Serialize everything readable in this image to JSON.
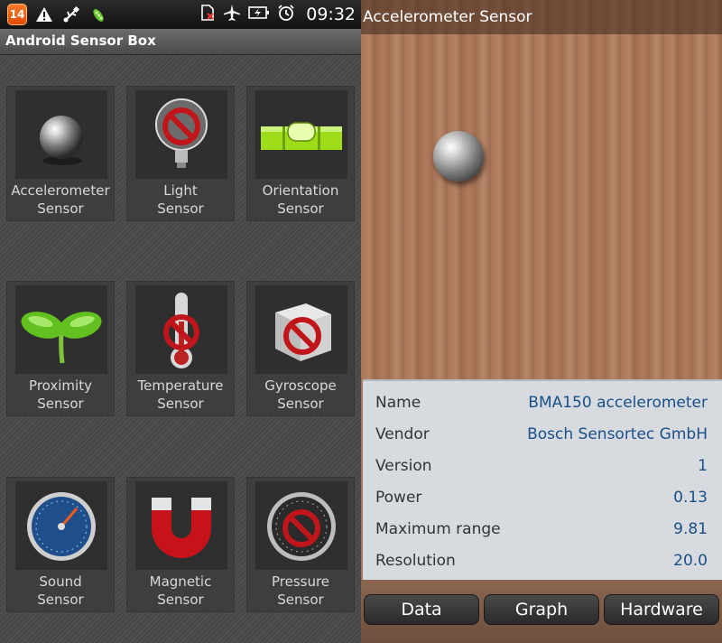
{
  "status_bar": {
    "notification_count": "14",
    "icons": [
      "warning-icon",
      "usb-icon",
      "peapod-app-icon"
    ],
    "right_icons": [
      "no-sim-icon",
      "airplane-icon",
      "battery-charging-icon",
      "alarm-icon"
    ],
    "time": "09:32"
  },
  "left_app": {
    "title": "Android Sensor Box",
    "tiles": [
      {
        "line1": "Accelerometer",
        "line2": "Sensor",
        "icon": "steel-ball-icon"
      },
      {
        "line1": "Light",
        "line2": "Sensor",
        "icon": "light-bulb-disabled-icon"
      },
      {
        "line1": "Orientation",
        "line2": "Sensor",
        "icon": "spirit-level-icon"
      },
      {
        "line1": "Proximity",
        "line2": "Sensor",
        "icon": "sprout-icon"
      },
      {
        "line1": "Temperature",
        "line2": "Sensor",
        "icon": "thermometer-disabled-icon"
      },
      {
        "line1": "Gyroscope",
        "line2": "Sensor",
        "icon": "cube-disabled-icon"
      },
      {
        "line1": "Sound",
        "line2": "Sensor",
        "icon": "gauge-icon"
      },
      {
        "line1": "Magnetic",
        "line2": "Sensor",
        "icon": "magnet-icon"
      },
      {
        "line1": "Pressure",
        "line2": "Sensor",
        "icon": "pressure-gauge-disabled-icon"
      }
    ]
  },
  "right_app": {
    "title": "Accelerometer Sensor",
    "info": [
      {
        "label": "Name",
        "value": "BMA150 accelerometer"
      },
      {
        "label": "Vendor",
        "value": "Bosch Sensortec GmbH"
      },
      {
        "label": "Version",
        "value": "1"
      },
      {
        "label": "Power",
        "value": "0.13"
      },
      {
        "label": "Maximum range",
        "value": "9.81"
      },
      {
        "label": "Resolution",
        "value": "20.0"
      }
    ],
    "tabs": [
      "Data",
      "Graph",
      "Hardware"
    ]
  },
  "colors": {
    "info_value": "#1a4f8a",
    "notification_badge": "#f06010",
    "wood": "#a9755a"
  }
}
